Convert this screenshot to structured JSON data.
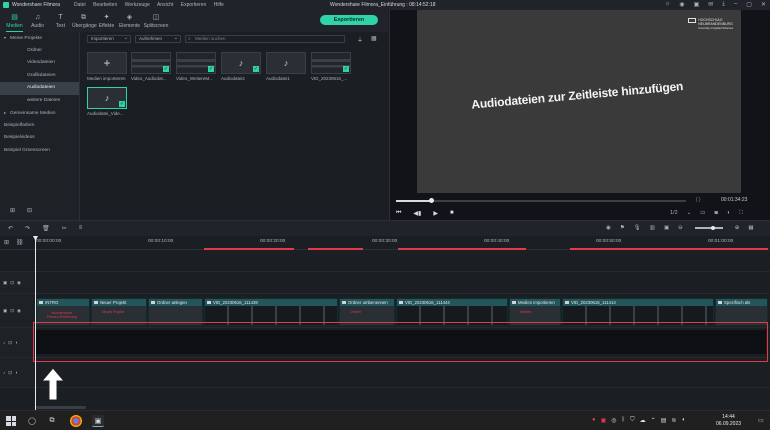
{
  "app": {
    "name": "Wondershare Filmora",
    "window_title": "Wondershare Filmora_Einführung : 08:14:52:18",
    "menu": [
      "Datei",
      "Bearbeiten",
      "Werkzeuge",
      "Ansicht",
      "Exportieren",
      "Hilfe"
    ]
  },
  "top_tabs": [
    {
      "label": "Medien",
      "icon": "media-folder-icon",
      "active": true
    },
    {
      "label": "Audio",
      "icon": "music-note-icon"
    },
    {
      "label": "Text",
      "icon": "text-T-icon"
    },
    {
      "label": "Übergänge",
      "icon": "transitions-icon"
    },
    {
      "label": "Effekte",
      "icon": "effects-icon"
    },
    {
      "label": "Elemente",
      "icon": "elements-icon"
    },
    {
      "label": "Splitscreen",
      "icon": "splitscreen-icon"
    }
  ],
  "export_label": "Exportieren",
  "sidebar": {
    "items": [
      {
        "label": "Meine Projekte",
        "level": 0,
        "arrow": "▾"
      },
      {
        "label": "Ordner",
        "level": 1
      },
      {
        "label": "Videodateien",
        "level": 1
      },
      {
        "label": "Grafikdateien",
        "level": 1
      },
      {
        "label": "Audiodateien",
        "level": 1,
        "active": true
      },
      {
        "label": "weitere Dateien",
        "level": 1
      },
      {
        "label": "Gemeinsame Medien",
        "level": 0,
        "arrow": "▸"
      },
      {
        "label": "Beispielfarben",
        "level": 0
      },
      {
        "label": "Beispielvideos",
        "level": 0
      },
      {
        "label": "Beispiel Greenscreen",
        "level": 0
      }
    ]
  },
  "media_toolbar": {
    "import_label": "Importieren",
    "record_label": "Aufnehmen",
    "search_placeholder": "Medien suchen"
  },
  "media_items": [
    {
      "label": "Medien importieren",
      "kind": "add"
    },
    {
      "label": "Video_Audiodat...",
      "kind": "video",
      "checked": true
    },
    {
      "label": "Video_WeitereM...",
      "kind": "video",
      "checked": true
    },
    {
      "label": "Audiodatei2",
      "kind": "audio",
      "checked": true
    },
    {
      "label": "Audiodatei1",
      "kind": "audio",
      "checked": false
    },
    {
      "label": "VID_20230616_...",
      "kind": "video",
      "checked": true
    },
    {
      "label": "Audiodatei_Vide...",
      "kind": "audio",
      "checked": true,
      "selected": true
    }
  ],
  "preview": {
    "caption": "Audiodateien zur Zeitleiste hinzufügen",
    "logo_lines": [
      "HOCHSCHULE",
      "NEUBRANDENBURG",
      "University of Applied Sciences"
    ],
    "timecode": "00:01:34:23",
    "marker_brackets": "{    }",
    "progress": 0.12,
    "page_ratio": "1/2"
  },
  "ruler": {
    "labels": [
      "00:00:00:00",
      "00:00:10:00",
      "00:00:20:00",
      "00:00:30:00",
      "00:00:40:00",
      "00:00:50:00",
      "00:01:00:00"
    ]
  },
  "clips": [
    {
      "label": "INTRO",
      "kind": "dark"
    },
    {
      "label": "Neuer Projekt",
      "kind": "title",
      "text": "Neues Projekt"
    },
    {
      "label": "Ordner anlegen",
      "kind": "dark"
    },
    {
      "label": "VID_20230616_111439",
      "kind": "film"
    },
    {
      "label": "Ordner umbenennen",
      "kind": "title",
      "text": "Ordner"
    },
    {
      "label": "VID_20230616_111444",
      "kind": "film"
    },
    {
      "label": "Medien importieren",
      "kind": "title",
      "text": "Medien"
    },
    {
      "label": "VID_20230616_111414",
      "kind": "film"
    },
    {
      "label": "Spezifisch als",
      "kind": "dark"
    }
  ],
  "intro_clip_text": [
    "Wondershare",
    "Filmora Einführung"
  ],
  "taskbar": {
    "time": "14:44",
    "date": "06.09.2023"
  }
}
